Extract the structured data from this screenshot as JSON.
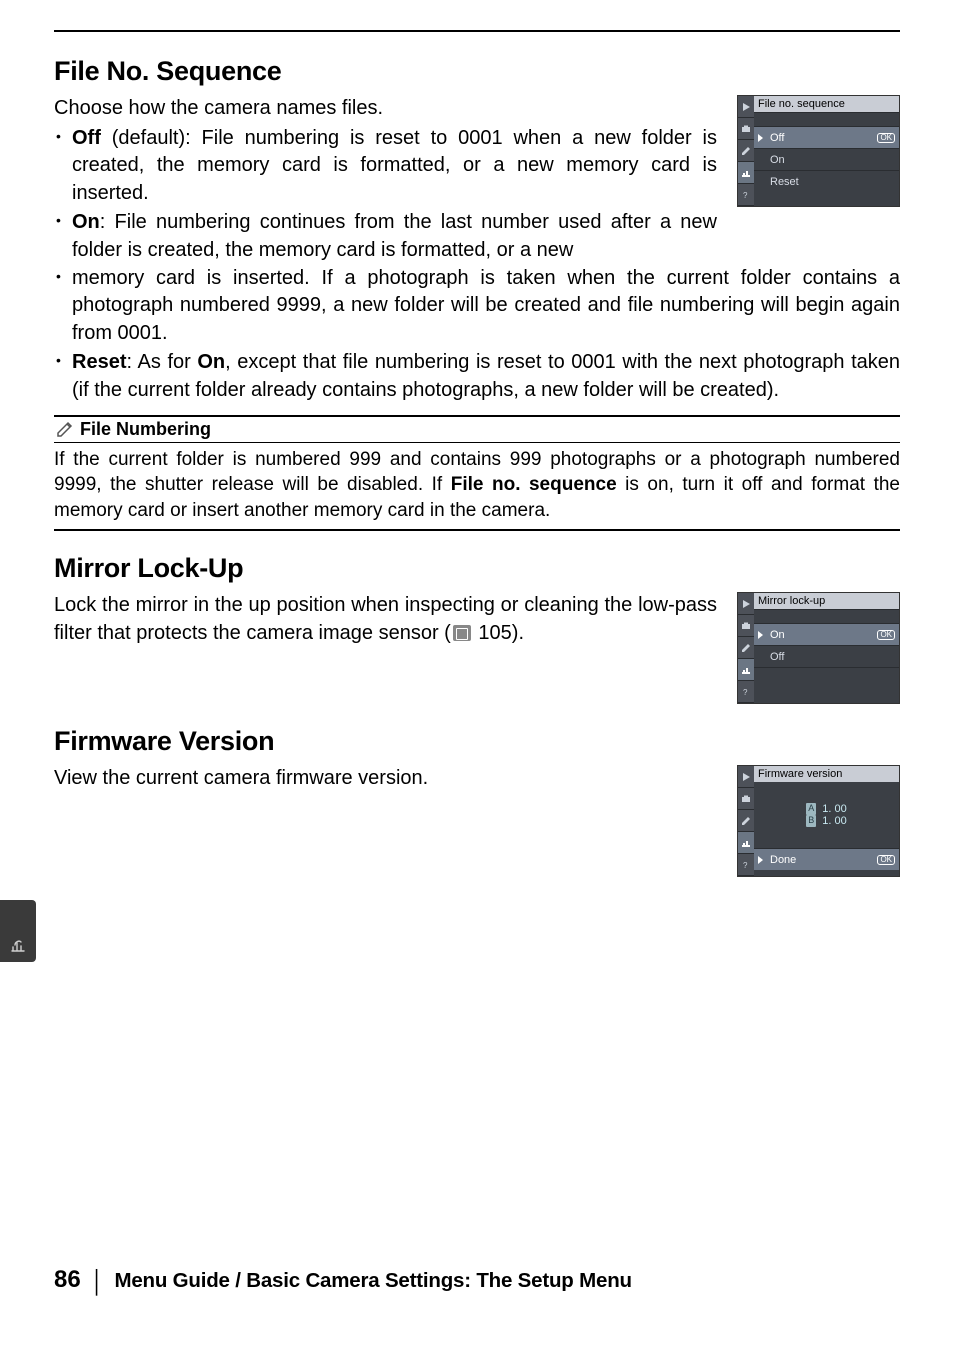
{
  "sections": {
    "fileno": {
      "title": "File No. Sequence",
      "intro": "Choose how the camera names files.",
      "opt_off_label": "Off",
      "opt_off_text": " (default): File numbering is reset to 0001 when a new folder is created, the memory card is formatted, or a new memory card is inserted.",
      "opt_on_label": "On",
      "opt_on_text_a": ": File numbering continues from the last number used after a new folder is created, the memory card is formatted, or a new",
      "opt_on_text_b": "memory card is inserted.  If a photograph is taken when the current folder contains a photograph numbered 9999, a new folder will be created and file numbering will begin again from 0001.",
      "opt_reset_label": "Reset",
      "opt_reset_text_a": ": As for ",
      "opt_reset_bold": "On",
      "opt_reset_text_b": ", except that file numbering is reset to 0001 with the next photograph taken (if the current folder already contains photographs, a new folder will be created).",
      "note_title": "File Numbering",
      "note_body_a": "If the current folder is numbered 999 and contains 999 photographs or a photograph numbered 9999, the shutter release will be disabled.  If ",
      "note_bold": "File no. sequence",
      "note_body_b": " is on, turn it off and format the memory card or insert another memory card in the camera.",
      "lcd": {
        "title": "File no. sequence",
        "items": [
          "Off",
          "On",
          "Reset"
        ],
        "sel_index": 0
      }
    },
    "mirror": {
      "title": "Mirror Lock-Up",
      "body_a": "Lock the mirror in the up position when inspecting or cleaning the low-pass filter that protects the camera image sensor (",
      "pgref": " 105",
      "body_b": ").",
      "lcd": {
        "title": "Mirror lock-up",
        "items": [
          "On",
          "Off"
        ],
        "sel_index": 0
      }
    },
    "firmware": {
      "title": "Firmware Version",
      "body": "View the current camera firmware version.",
      "lcd": {
        "title": "Firmware version",
        "versions": [
          "1. 00",
          "1. 00"
        ],
        "done": "Done"
      }
    }
  },
  "ok_label": "OK",
  "version_tags": [
    "A",
    "B"
  ],
  "footer": {
    "page": "86",
    "title": "Menu Guide / Basic Camera Settings: The Setup Menu"
  }
}
